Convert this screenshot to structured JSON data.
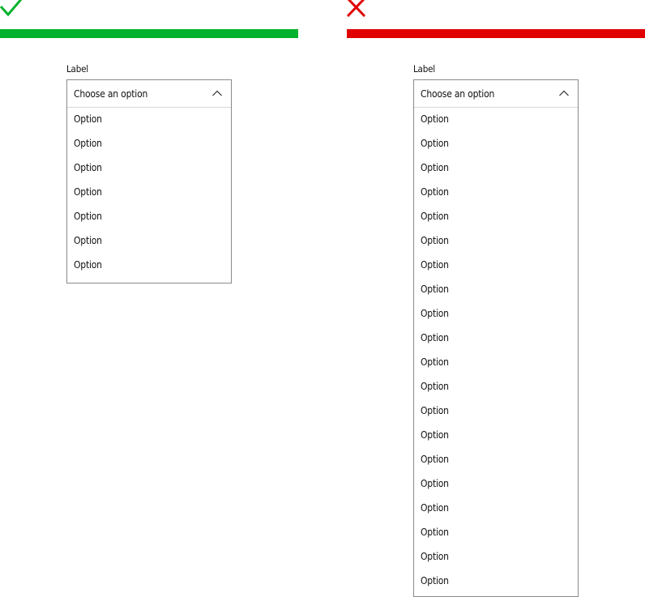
{
  "good_example": {
    "status_icon": "checkmark-icon",
    "color": "#00b22d",
    "dropdown": {
      "label": "Label",
      "selected_placeholder": "Choose an option",
      "chevron_icon": "chevron-up-icon",
      "options": [
        "Option",
        "Option",
        "Option",
        "Option",
        "Option",
        "Option",
        "Option"
      ]
    }
  },
  "bad_example": {
    "status_icon": "cross-icon",
    "color": "#e00000",
    "dropdown": {
      "label": "Label",
      "selected_placeholder": "Choose an option",
      "chevron_icon": "chevron-up-icon",
      "options": [
        "Option",
        "Option",
        "Option",
        "Option",
        "Option",
        "Option",
        "Option",
        "Option",
        "Option",
        "Option",
        "Option",
        "Option",
        "Option",
        "Option",
        "Option",
        "Option",
        "Option",
        "Option",
        "Option",
        "Option"
      ]
    }
  }
}
